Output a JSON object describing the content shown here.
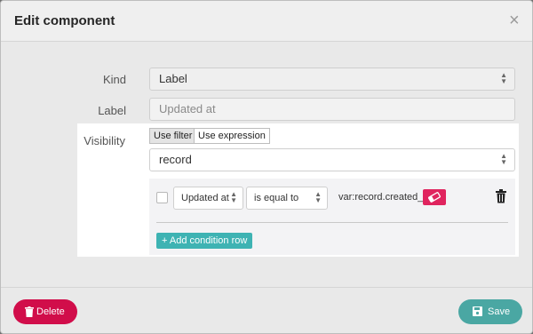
{
  "modal": {
    "title": "Edit component",
    "close_glyph": "×"
  },
  "form": {
    "kind_label": "Kind",
    "kind_value": "Label",
    "label_label": "Label",
    "label_value": "Updated at",
    "visibility_label": "Visibility",
    "tabs": [
      {
        "label": "Use filter",
        "active": true
      },
      {
        "label": "Use expression",
        "active": false
      }
    ],
    "record_value": "record",
    "condition": {
      "field_value": "Updated at",
      "operator_value": "is equal to",
      "value_text": "var:record.created_at"
    },
    "add_row_label": "Add condition row"
  },
  "footer": {
    "delete_label": "Delete",
    "save_label": "Save"
  },
  "colors": {
    "delete": "#d10d4a",
    "save": "#4aa7a3",
    "add_row": "#3eb3b3",
    "eraser": "#e0245e"
  },
  "icons": [
    "close-icon",
    "select-arrows-icon",
    "eraser-icon",
    "trash-icon",
    "plus-icon",
    "delete-trash-icon",
    "save-disk-icon"
  ]
}
